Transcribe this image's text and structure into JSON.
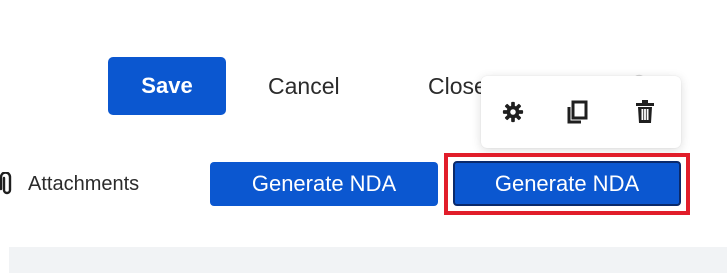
{
  "toolbar": {
    "save_label": "Save",
    "cancel_label": "Cancel",
    "close_label": "Close"
  },
  "popover": {
    "icons": [
      "gear-icon",
      "copy-icon",
      "trash-icon"
    ]
  },
  "row2": {
    "attachments_label": "Attachments",
    "generate_nda_label": "Generate NDA",
    "generate_nda_highlighted_label": "Generate NDA"
  },
  "colors": {
    "primary": "#0b57d0",
    "highlight": "#e11d2a",
    "text": "#2b2b2b",
    "band": "#f1f3f5"
  }
}
